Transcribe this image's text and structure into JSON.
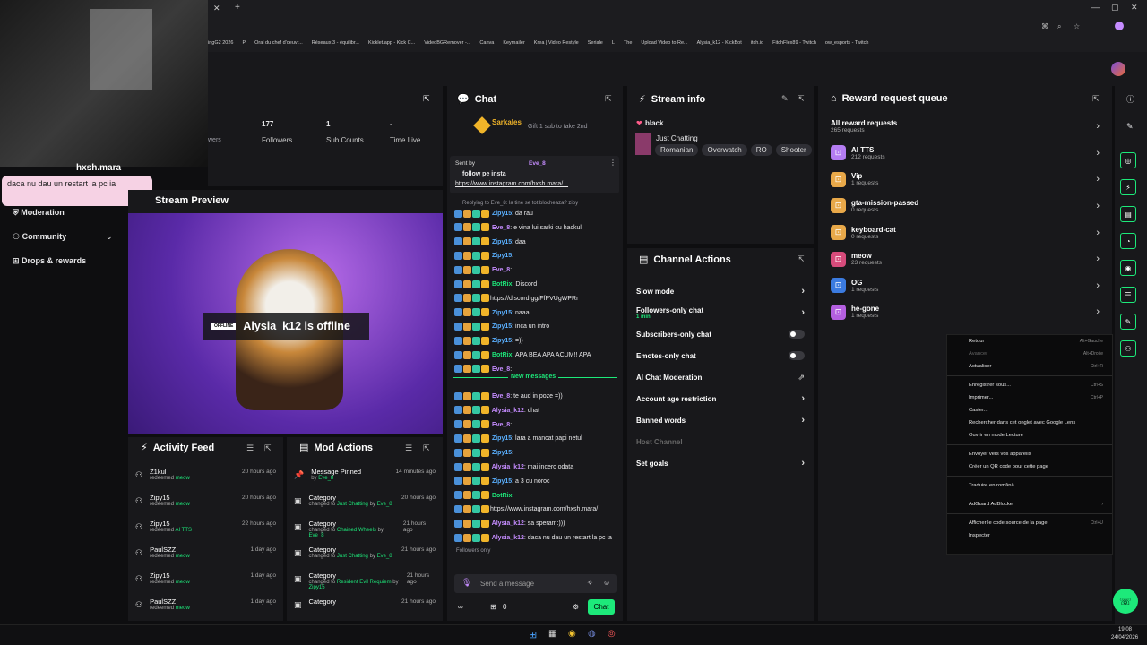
{
  "browser": {
    "bookmarks": [
      "ingG2 2026",
      "P",
      "Oral du chef d'oeuvr...",
      "Réseaux 3 - équilibr...",
      "Kicklet.app - Kick C...",
      "VideoBGRemover -...",
      "Canva",
      "Keymailer",
      "Krea | Video Restyle",
      "Seriale",
      "L",
      "The",
      "Upload Video to Re...",
      "Alysia_k12 - KickBot",
      "itch.io",
      "FitchFlex89 - Twitch",
      "ow_esports - Twitch"
    ]
  },
  "stats": {
    "followers_value": "177",
    "followers_label": "Followers",
    "subs_value": "1",
    "subs_label": "Sub Counts",
    "time_value": "-",
    "time_label": "Time Live",
    "viewers_label": "wers"
  },
  "overlay": {
    "username": "hxsh.mara",
    "message": "daca nu dau un restart la pc ia"
  },
  "nav": {
    "moderation": "Moderation",
    "community": "Community",
    "drops": "Drops & rewards"
  },
  "preview": {
    "title": "Stream Preview",
    "badge": "OFFLINE",
    "status": "Alysia_k12 is offline"
  },
  "activity": {
    "title": "Activity Feed",
    "items": [
      {
        "name": "Z1kul",
        "sub": "redeemed",
        "reward": "meow",
        "time": "20 hours ago"
      },
      {
        "name": "Zipy15",
        "sub": "redeemed",
        "reward": "meow",
        "time": "20 hours ago"
      },
      {
        "name": "Zipy15",
        "sub": "redeemed",
        "reward": "AI TTS",
        "time": "22 hours ago"
      },
      {
        "name": "PaulSZZ",
        "sub": "redeemed",
        "reward": "meow",
        "time": "1 day ago"
      },
      {
        "name": "Zipy15",
        "sub": "redeemed",
        "reward": "meow",
        "time": "1 day ago"
      },
      {
        "name": "PaulSZZ",
        "sub": "redeemed",
        "reward": "meow",
        "time": "1 day ago"
      }
    ]
  },
  "mod": {
    "title": "Mod Actions",
    "items": [
      {
        "name": "Message Pinned",
        "sub": "by",
        "who": "Eve_8",
        "time": "14 minutes ago"
      },
      {
        "name": "Category",
        "sub": "changed to",
        "what": "Just Chatting",
        "by": "by",
        "who": "Eve_8",
        "time": "20 hours ago"
      },
      {
        "name": "Category",
        "sub": "changed to",
        "what": "Chained Wheels",
        "by": "by",
        "who": "Eve_8",
        "time": "21 hours ago"
      },
      {
        "name": "Category",
        "sub": "changed to",
        "what": "Just Chatting",
        "by": "by",
        "who": "Eve_8",
        "time": "21 hours ago"
      },
      {
        "name": "Category",
        "sub": "changed to",
        "what": "Resident Evil Requiem",
        "by": "by",
        "who": "Zipy15",
        "time": "21 hours ago"
      },
      {
        "name": "Category",
        "sub": "",
        "what": "",
        "by": "",
        "who": "",
        "time": "21 hours ago"
      }
    ]
  },
  "chat": {
    "title": "Chat",
    "top_user": "Sarkales",
    "gift_text": "Gift 1 sub to take 2nd",
    "pinned_sent_by": "Sent by",
    "pinned_user": "Eve_8",
    "pinned_msg": "follow pe insta",
    "pinned_link": "https://www.instagram.com/hxsh.mara/...",
    "reply_note": "Replying to Eve_8: la tine se tot blocheaza? zipy",
    "messages": [
      {
        "user": "Zipy15",
        "color": "#5ab0ff",
        "text": "da rau"
      },
      {
        "user": "Eve_8",
        "color": "#c58cff",
        "text": "e vina lui sarki cu hackul"
      },
      {
        "user": "Zipy15",
        "color": "#5ab0ff",
        "text": "daa"
      },
      {
        "user": "Zipy15",
        "color": "#5ab0ff",
        "text": ""
      },
      {
        "user": "Eve_8",
        "color": "#c58cff",
        "text": ""
      },
      {
        "user": "BotRix",
        "color": "#1de97a",
        "text": "Discord"
      },
      {
        "user": "",
        "color": "#e8e8ea",
        "text": "https://discord.gg/FfPVUgWPRr"
      },
      {
        "user": "Zipy15",
        "color": "#5ab0ff",
        "text": "naaa"
      },
      {
        "user": "Zipy15",
        "color": "#5ab0ff",
        "text": "inca un intro"
      },
      {
        "user": "Zipy15",
        "color": "#5ab0ff",
        "text": "=))"
      },
      {
        "user": "BotRix",
        "color": "#1de97a",
        "text": "APA BEA APA ACUM!! APA"
      },
      {
        "user": "Eve_8",
        "color": "#c58cff",
        "text": ""
      }
    ],
    "new_messages": "New messages",
    "messages2": [
      {
        "user": "Eve_8",
        "color": "#c58cff",
        "text": "te aud in poze =))"
      },
      {
        "user": "Alysia_k12",
        "color": "#c58cff",
        "text": "chat"
      },
      {
        "user": "Eve_8",
        "color": "#c58cff",
        "text": ""
      },
      {
        "user": "Zipy15",
        "color": "#5ab0ff",
        "text": "lara a mancat papi netul"
      },
      {
        "user": "Zipy15",
        "color": "#5ab0ff",
        "text": ""
      },
      {
        "user": "Alysia_k12",
        "color": "#c58cff",
        "text": "mai incerc odata"
      },
      {
        "user": "Zipy15",
        "color": "#5ab0ff",
        "text": "a 3 cu noroc"
      },
      {
        "user": "BotRix",
        "color": "#1de97a",
        "text": ""
      },
      {
        "user": "",
        "color": "#e8e8ea",
        "text": "https://www.instagram.com/hxsh.mara/"
      },
      {
        "user": "Alysia_k12",
        "color": "#c58cff",
        "text": "sa speram:)))"
      },
      {
        "user": "Alysia_k12",
        "color": "#c58cff",
        "text": "daca nu dau un restart la pc ia"
      }
    ],
    "followers_only": "Followers only",
    "placeholder": "Send a message",
    "count": "0",
    "chat_btn": "Chat"
  },
  "stream_info": {
    "title": "Stream info",
    "stream_title": "black",
    "category": "Just Chatting",
    "tags": [
      "Romanian",
      "Overwatch",
      "RO",
      "Shooter"
    ]
  },
  "channel": {
    "title": "Channel Actions",
    "rows": [
      {
        "label": "Slow mode",
        "sub": "",
        "kind": "chev"
      },
      {
        "label": "Followers-only chat",
        "sub": "1 min",
        "kind": "chev"
      },
      {
        "label": "Subscribers-only chat",
        "sub": "",
        "kind": "toggle"
      },
      {
        "label": "Emotes-only chat",
        "sub": "",
        "kind": "toggle"
      },
      {
        "label": "AI Chat Moderation",
        "sub": "",
        "kind": "ext"
      },
      {
        "label": "Account age restriction",
        "sub": "",
        "kind": "chev"
      },
      {
        "label": "Banned words",
        "sub": "",
        "kind": "chev"
      },
      {
        "label": "Host Channel",
        "sub": "",
        "kind": "disabled"
      },
      {
        "label": "Set goals",
        "sub": "",
        "kind": "chev"
      }
    ]
  },
  "rewards": {
    "title": "Reward request queue",
    "all_label": "All reward requests",
    "all_count": "265 requests",
    "items": [
      {
        "name": "AI TTS",
        "count": "212 requests",
        "color": "#b47cf2"
      },
      {
        "name": "Vip",
        "count": "1 requests",
        "color": "#e8a849"
      },
      {
        "name": "gta-mission-passed",
        "count": "0 requests",
        "color": "#e8a849"
      },
      {
        "name": "keyboard-cat",
        "count": "0 requests",
        "color": "#e8a849"
      },
      {
        "name": "meow",
        "count": "23 requests",
        "color": "#d64b7b"
      },
      {
        "name": "OG",
        "count": "1 requests",
        "color": "#3b7be0"
      },
      {
        "name": "he-gone",
        "count": "1 requests",
        "color": "#b45fe0"
      }
    ]
  },
  "context_menu": {
    "items": [
      {
        "label": "Retour",
        "key": "Alt+Gauche"
      },
      {
        "label": "Avancer",
        "key": "Alt+Droite",
        "disabled": true
      },
      {
        "label": "Actualiser",
        "key": "Ctrl+R"
      },
      {
        "sep": true
      },
      {
        "label": "Enregistrer sous...",
        "key": "Ctrl+S"
      },
      {
        "label": "Imprimer...",
        "key": "Ctrl+P"
      },
      {
        "label": "Caster...",
        "key": ""
      },
      {
        "label": "Rechercher dans cet onglet avec Google Lens",
        "key": ""
      },
      {
        "label": "Ouvrir en mode Lecture",
        "key": ""
      },
      {
        "sep": true
      },
      {
        "label": "Envoyer vers vos appareils",
        "key": ""
      },
      {
        "label": "Créer un QR code pour cette page",
        "key": ""
      },
      {
        "sep": true
      },
      {
        "label": "Traduire en română",
        "key": ""
      },
      {
        "sep": true
      },
      {
        "label": "AdGuard AdBlocker",
        "key": "›"
      },
      {
        "sep": true
      },
      {
        "label": "Afficher le code source de la page",
        "key": "Ctrl+U"
      },
      {
        "label": "Inspecter",
        "key": ""
      }
    ]
  },
  "taskbar": {
    "time": "19:08",
    "date": "24/04/2026"
  }
}
